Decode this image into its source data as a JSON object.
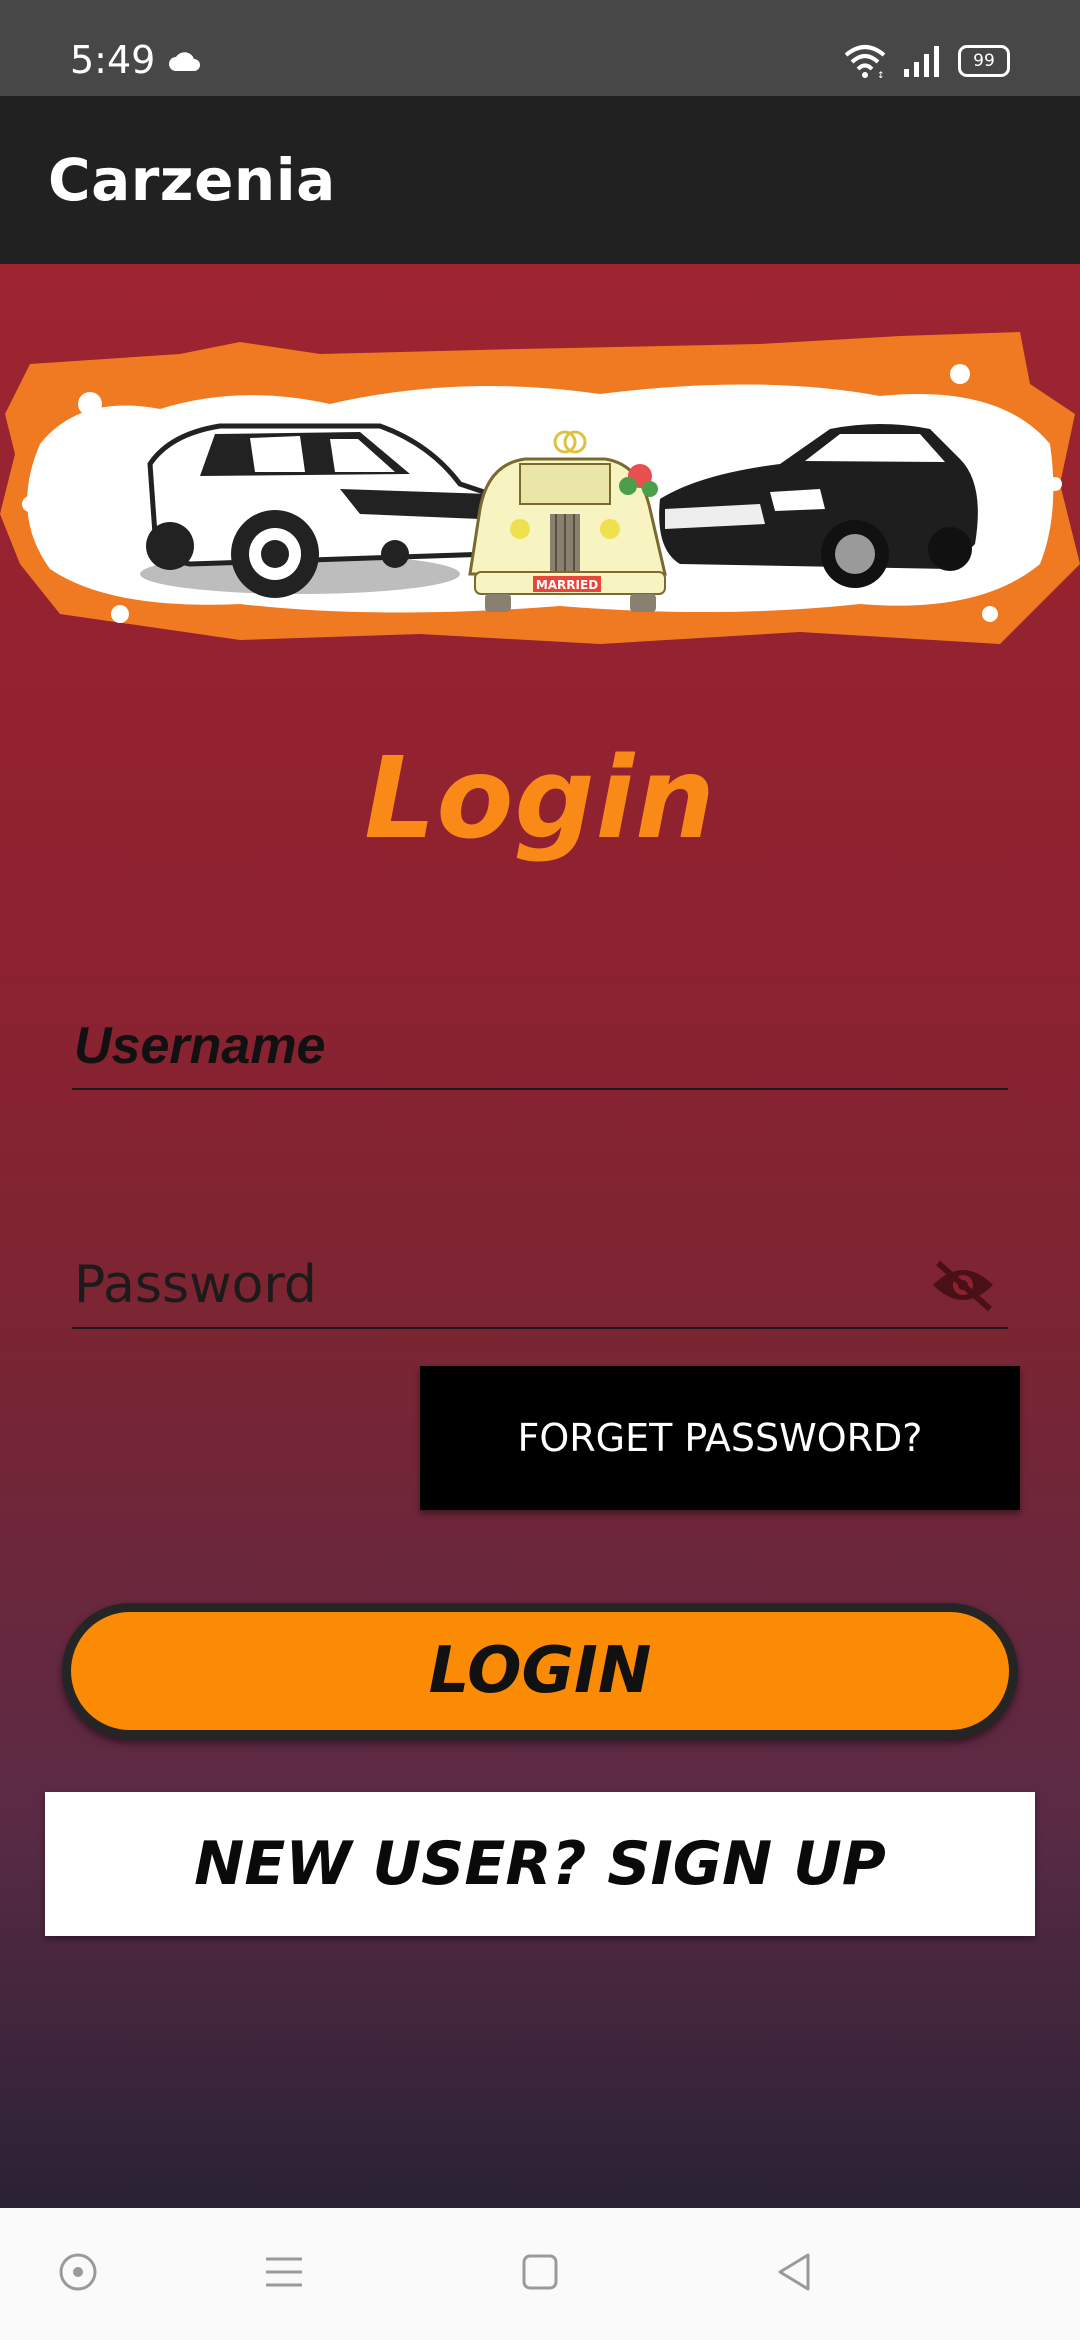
{
  "status_bar": {
    "time": "5:49",
    "battery": "99",
    "icons": [
      "cloud-icon",
      "wifi-icon",
      "signal-icon",
      "battery-icon"
    ]
  },
  "app_bar": {
    "title": "Carzenia"
  },
  "banner": {
    "plate_text": "MARRIED"
  },
  "login": {
    "title": "Login",
    "username_placeholder": "Username",
    "password_placeholder": "Password",
    "forgot_label": "FORGET PASSWORD?",
    "login_label": "LOGIN",
    "signup_label": "NEW USER? SIGN UP"
  },
  "colors": {
    "accent": "#fb8a04",
    "title": "#fa8a18",
    "background_top": "#9e2431",
    "background_bottom": "#2a2234",
    "app_bar": "#212121"
  },
  "navbar": {
    "icons": [
      "circle-icon",
      "menu-icon",
      "square-icon",
      "back-icon"
    ]
  }
}
